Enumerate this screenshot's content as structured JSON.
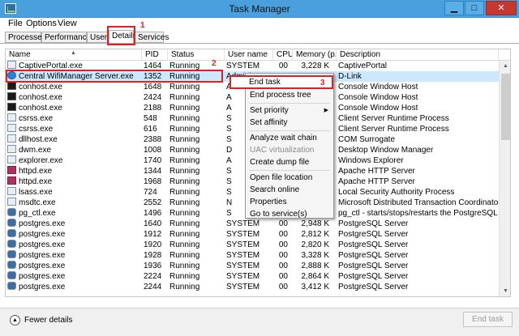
{
  "window": {
    "title": "Task Manager",
    "controls": {
      "minimize": "▁",
      "maximize": "□",
      "close": "✕"
    }
  },
  "menu": [
    "File",
    "Options",
    "View"
  ],
  "tabs": [
    {
      "label": "Processes",
      "active": false
    },
    {
      "label": "Performance",
      "active": false
    },
    {
      "label": "Users",
      "active": false
    },
    {
      "label": "Details",
      "active": true
    },
    {
      "label": "Services",
      "active": false
    }
  ],
  "annotations": {
    "step1": "1",
    "step2": "2",
    "step3": "3"
  },
  "columns": {
    "name": "Name",
    "pid": "PID",
    "status": "Status",
    "user": "User name",
    "cpu": "CPU",
    "memory": "Memory (p...",
    "description": "Description"
  },
  "rows": [
    {
      "icon": "app-icon",
      "name": "CaptivePortal.exe",
      "pid": "1464",
      "status": "Running",
      "user": "SYSTEM",
      "cpu": "00",
      "mem": "3,228 K",
      "desc": "CaptivePortal"
    },
    {
      "icon": "globe-icon",
      "name": "Central WifiManager Server.exe",
      "pid": "1352",
      "status": "Running",
      "user": "Administ",
      "cpu": "",
      "mem": "",
      "desc": "D-Link",
      "selected": true
    },
    {
      "icon": "console-icon",
      "name": "conhost.exe",
      "pid": "1648",
      "status": "Running",
      "user": "A",
      "cpu": "",
      "mem": "",
      "desc": "Console Window Host"
    },
    {
      "icon": "console-icon",
      "name": "conhost.exe",
      "pid": "2424",
      "status": "Running",
      "user": "A",
      "cpu": "",
      "mem": "",
      "desc": "Console Window Host"
    },
    {
      "icon": "console-icon",
      "name": "conhost.exe",
      "pid": "2188",
      "status": "Running",
      "user": "A",
      "cpu": "",
      "mem": "",
      "desc": "Console Window Host"
    },
    {
      "icon": "app-icon",
      "name": "csrss.exe",
      "pid": "548",
      "status": "Running",
      "user": "S",
      "cpu": "",
      "mem": "",
      "desc": "Client Server Runtime Process"
    },
    {
      "icon": "app-icon",
      "name": "csrss.exe",
      "pid": "616",
      "status": "Running",
      "user": "S",
      "cpu": "",
      "mem": "",
      "desc": "Client Server Runtime Process"
    },
    {
      "icon": "app-icon",
      "name": "dllhost.exe",
      "pid": "2388",
      "status": "Running",
      "user": "S",
      "cpu": "",
      "mem": "",
      "desc": "COM Surrogate"
    },
    {
      "icon": "app-icon",
      "name": "dwm.exe",
      "pid": "1008",
      "status": "Running",
      "user": "D",
      "cpu": "",
      "mem": "",
      "desc": "Desktop Window Manager"
    },
    {
      "icon": "app-icon",
      "name": "explorer.exe",
      "pid": "1740",
      "status": "Running",
      "user": "A",
      "cpu": "",
      "mem": "",
      "desc": "Windows Explorer"
    },
    {
      "icon": "apache-icon",
      "name": "httpd.exe",
      "pid": "1344",
      "status": "Running",
      "user": "S",
      "cpu": "",
      "mem": "",
      "desc": "Apache HTTP Server"
    },
    {
      "icon": "apache-icon",
      "name": "httpd.exe",
      "pid": "1968",
      "status": "Running",
      "user": "S",
      "cpu": "",
      "mem": "",
      "desc": "Apache HTTP Server"
    },
    {
      "icon": "app-icon",
      "name": "lsass.exe",
      "pid": "724",
      "status": "Running",
      "user": "S",
      "cpu": "",
      "mem": "",
      "desc": "Local Security Authority Process"
    },
    {
      "icon": "app-icon",
      "name": "msdtc.exe",
      "pid": "2552",
      "status": "Running",
      "user": "N",
      "cpu": "",
      "mem": "",
      "desc": "Microsoft Distributed Transaction Coordinator Service"
    },
    {
      "icon": "elephant-icon",
      "name": "pg_ctl.exe",
      "pid": "1496",
      "status": "Running",
      "user": "S",
      "cpu": "",
      "mem": "",
      "desc": "pg_ctl - starts/stops/restarts the PostgreSQL server"
    },
    {
      "icon": "elephant-icon",
      "name": "postgres.exe",
      "pid": "1640",
      "status": "Running",
      "user": "SYSTEM",
      "cpu": "00",
      "mem": "2,948 K",
      "desc": "PostgreSQL Server"
    },
    {
      "icon": "elephant-icon",
      "name": "postgres.exe",
      "pid": "1912",
      "status": "Running",
      "user": "SYSTEM",
      "cpu": "00",
      "mem": "2,812 K",
      "desc": "PostgreSQL Server"
    },
    {
      "icon": "elephant-icon",
      "name": "postgres.exe",
      "pid": "1920",
      "status": "Running",
      "user": "SYSTEM",
      "cpu": "00",
      "mem": "2,820 K",
      "desc": "PostgreSQL Server"
    },
    {
      "icon": "elephant-icon",
      "name": "postgres.exe",
      "pid": "1928",
      "status": "Running",
      "user": "SYSTEM",
      "cpu": "00",
      "mem": "3,328 K",
      "desc": "PostgreSQL Server"
    },
    {
      "icon": "elephant-icon",
      "name": "postgres.exe",
      "pid": "1936",
      "status": "Running",
      "user": "SYSTEM",
      "cpu": "00",
      "mem": "2,888 K",
      "desc": "PostgreSQL Server"
    },
    {
      "icon": "elephant-icon",
      "name": "postgres.exe",
      "pid": "2224",
      "status": "Running",
      "user": "SYSTEM",
      "cpu": "00",
      "mem": "2,864 K",
      "desc": "PostgreSQL Server"
    },
    {
      "icon": "elephant-icon",
      "name": "postgres.exe",
      "pid": "2244",
      "status": "Running",
      "user": "SYSTEM",
      "cpu": "00",
      "mem": "3,412 K",
      "desc": "PostgreSQL Server"
    }
  ],
  "context_menu": {
    "end_task": "End task",
    "end_process_tree": "End process tree",
    "set_priority": "Set priority",
    "set_affinity": "Set affinity",
    "analyze_wait_chain": "Analyze wait chain",
    "uac_virtualization": "UAC virtualization",
    "create_dump_file": "Create dump file",
    "open_file_location": "Open file location",
    "search_online": "Search online",
    "properties": "Properties",
    "go_to_services": "Go to service(s)"
  },
  "footer": {
    "fewer_details": "Fewer details",
    "end_task_button": "End task"
  }
}
